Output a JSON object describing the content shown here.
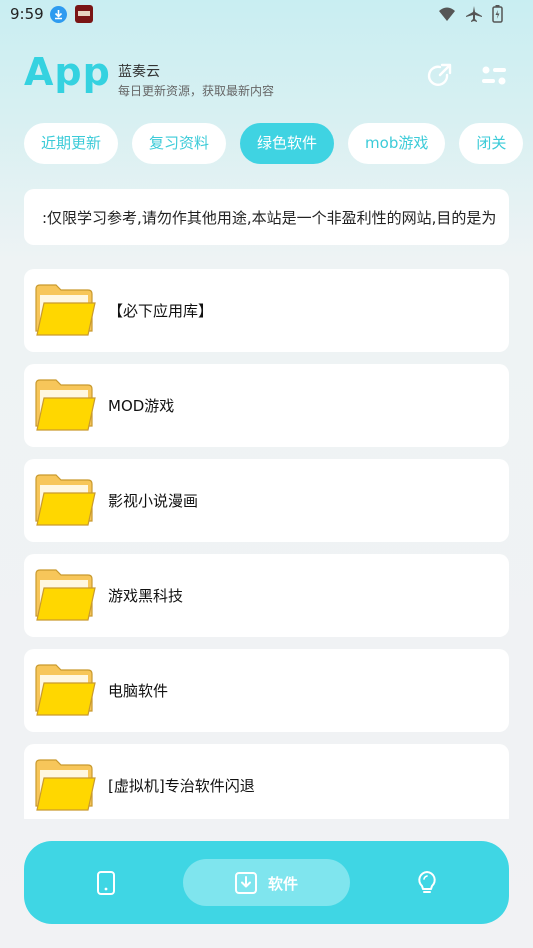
{
  "status": {
    "time": "9:59",
    "icons": [
      "download-icon",
      "app-notification-icon",
      "wifi-icon",
      "airplane-icon",
      "battery-icon"
    ]
  },
  "header": {
    "logo": "App",
    "site_name": "蓝奏云",
    "subtitle": "每日更新资源，获取最新内容",
    "icons": [
      "share-icon",
      "menu-icon"
    ]
  },
  "tabs": [
    {
      "label": "近期更新",
      "active": false
    },
    {
      "label": "复习资料",
      "active": false
    },
    {
      "label": "绿色软件",
      "active": true
    },
    {
      "label": "mob游戏",
      "active": false
    },
    {
      "label": "闭关",
      "active": false
    }
  ],
  "notice": ":仅限学习参考,请勿作其他用途,本站是一个非盈利性的网站,目的是为",
  "folders": [
    "【必下应用库】",
    "MOD游戏",
    "影视小说漫画",
    "游戏黑科技",
    "电脑软件",
    "[虚拟机]专治软件闪退"
  ],
  "bottom_nav": {
    "phone_icon": "phone-icon",
    "software_label": "软件",
    "software_icon": "download-box-icon",
    "tips_icon": "lightbulb-icon"
  },
  "colors": {
    "accent": "#3fd3e2",
    "folder": "#ffd700"
  }
}
